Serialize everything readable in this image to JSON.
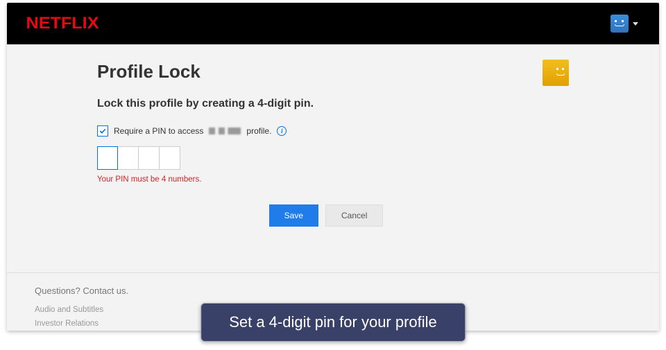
{
  "header": {
    "logo": "NETFLIX"
  },
  "page": {
    "title": "Profile Lock",
    "subtitle": "Lock this profile by creating a 4-digit pin.",
    "checkbox_prefix": "Require a PIN to access",
    "checkbox_suffix": "profile.",
    "error": "Your PIN must be 4 numbers.",
    "save": "Save",
    "cancel": "Cancel"
  },
  "footer": {
    "questions": "Questions? Contact us.",
    "links": [
      "Audio and Subtitles",
      "Investor Relations"
    ]
  },
  "caption": "Set a 4-digit pin for your profile"
}
